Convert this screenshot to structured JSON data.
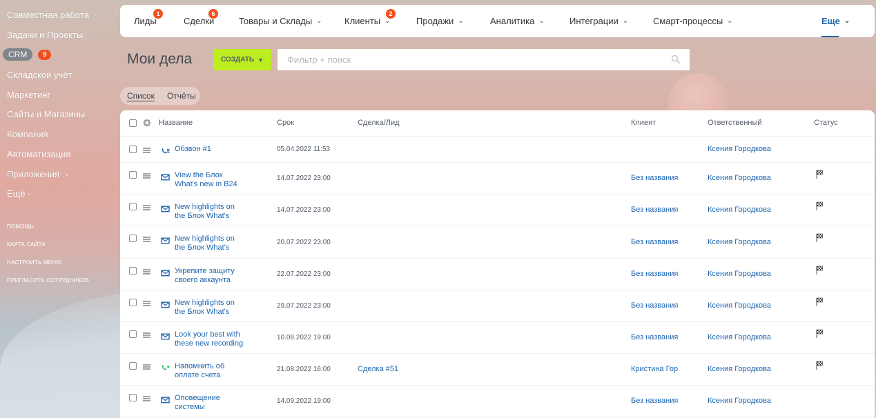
{
  "sidebar": {
    "items": [
      {
        "label": "Совместная работа",
        "chevron": true
      },
      {
        "label": "Задачи и Проекты"
      },
      {
        "label": "CRM",
        "badge": "9"
      },
      {
        "label": "Складской учёт"
      },
      {
        "label": "Маркетинг"
      },
      {
        "label": "Сайты и Магазины"
      },
      {
        "label": "Компания"
      },
      {
        "label": "Автоматизация"
      },
      {
        "label": "Приложения",
        "chevron": true
      },
      {
        "label": "Ещё -"
      }
    ],
    "footer": [
      "помощь",
      "карта сайта",
      "настроить меню",
      "пригласить сотрудников"
    ]
  },
  "topnav": {
    "items": [
      {
        "label": "Лиды",
        "badge": "1"
      },
      {
        "label": "Сделки",
        "badge": "6"
      },
      {
        "label": "Товары и Склады",
        "chevron": true
      },
      {
        "label": "Клиенты",
        "badge": "2",
        "chevron": true
      },
      {
        "label": "Продажи",
        "chevron": true
      },
      {
        "label": "Аналитика",
        "chevron": true
      },
      {
        "label": "Интеграции",
        "chevron": true
      },
      {
        "label": "Смарт-процессы",
        "chevron": true
      },
      {
        "label": "Еще",
        "chevron": true,
        "active": true
      }
    ]
  },
  "header": {
    "title": "Мои дела",
    "create_label": "СОЗДАТЬ",
    "search_placeholder": "Фильтр + поиск"
  },
  "tabs": [
    {
      "label": "Список",
      "active": true
    },
    {
      "label": "Отчёты"
    }
  ],
  "table": {
    "columns": [
      "Название",
      "Срок",
      "Сделка/Лид",
      "Клиент",
      "Ответственный",
      "Статус"
    ],
    "rows": [
      {
        "icon": "phone-icon",
        "title": [
          "Обзвон #1"
        ],
        "date": "05.04.2022 11:53",
        "deal": "",
        "client": "",
        "responsible": "Ксения Городкова",
        "flag": false
      },
      {
        "icon": "email-icon",
        "title": [
          "View the Блок",
          "What's new in B24"
        ],
        "date": "14.07.2022 23:00",
        "deal": "",
        "client": "Без названия",
        "responsible": "Ксения Городкова",
        "flag": true
      },
      {
        "icon": "email-icon",
        "title": [
          "New highlights on",
          "the Блок What's"
        ],
        "date": "14.07.2022 23:00",
        "deal": "",
        "client": "Без названия",
        "responsible": "Ксения Городкова",
        "flag": true
      },
      {
        "icon": "email-icon",
        "title": [
          "New highlights on",
          "the Блок What's"
        ],
        "date": "20.07.2022 23:00",
        "deal": "",
        "client": "Без названия",
        "responsible": "Ксения Городкова",
        "flag": true
      },
      {
        "icon": "email-icon",
        "title": [
          "Укрепите защиту",
          "своего аккаунта"
        ],
        "date": "22.07.2022 23:00",
        "deal": "",
        "client": "Без названия",
        "responsible": "Ксения Городкова",
        "flag": true
      },
      {
        "icon": "email-icon",
        "title": [
          "New highlights on",
          "the Блок What's"
        ],
        "date": "29.07.2022 23:00",
        "deal": "",
        "client": "Без названия",
        "responsible": "Ксения Городкова",
        "flag": true
      },
      {
        "icon": "email-icon",
        "title": [
          "Look your best with",
          "these new recording"
        ],
        "date": "10.08.2022 19:00",
        "deal": "",
        "client": "Без названия",
        "responsible": "Ксения Городкова",
        "flag": true
      },
      {
        "icon": "call-green-icon",
        "title": [
          "Напомнить об",
          "оплате счета"
        ],
        "date": "21.08.2022 16:00",
        "deal": "Сделка #51",
        "client": "Кристина Гор",
        "responsible": "Ксения Городкова",
        "flag": true
      },
      {
        "icon": "email-icon",
        "title": [
          "Оповещение",
          "системы"
        ],
        "date": "14.09.2022 19:00",
        "deal": "",
        "client": "Без названия",
        "responsible": "Ксения Городкова",
        "flag": false
      }
    ]
  },
  "colors": {
    "accent": "#2067b0",
    "create": "#bbed21",
    "badge": "#f0501f",
    "call_green": "#2fc26e"
  }
}
